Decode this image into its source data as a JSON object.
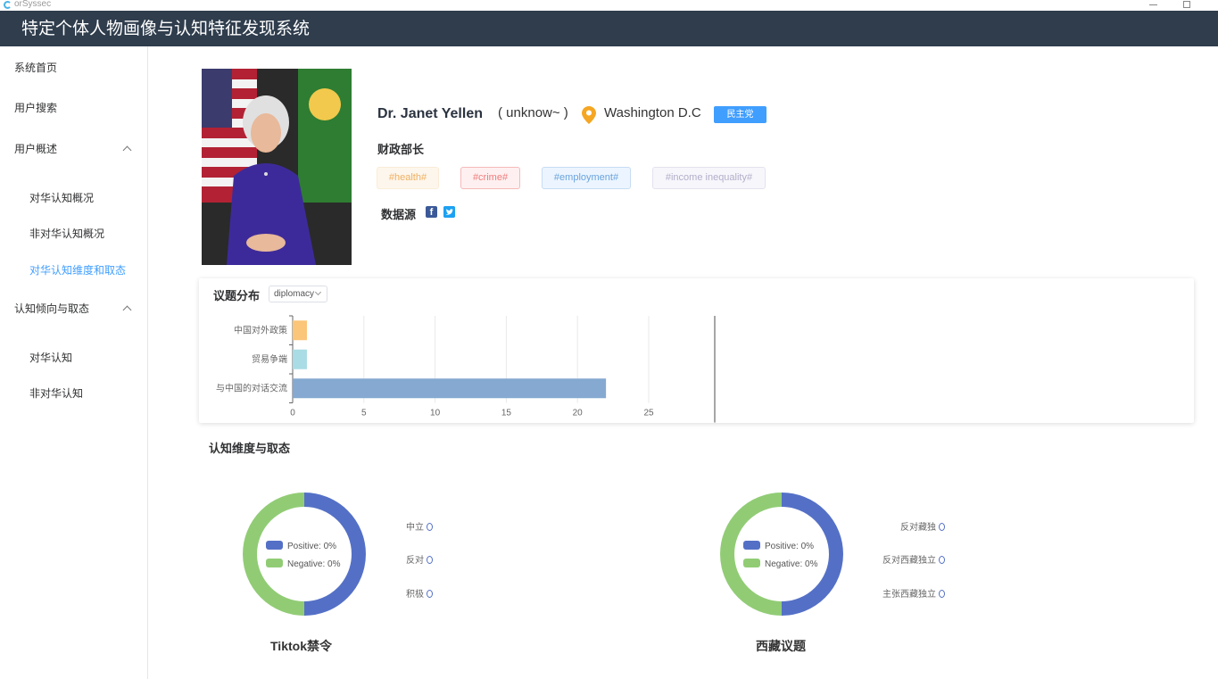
{
  "app": {
    "window_title": "orSyssec",
    "header_title": "特定个体人物画像与认知特征发现系统"
  },
  "sidebar": {
    "items": [
      {
        "label": "系统首页"
      },
      {
        "label": "用户搜索"
      },
      {
        "label": "用户概述",
        "expanded": true
      },
      {
        "label": "对华认知概况"
      },
      {
        "label": "非对华认知概况"
      },
      {
        "label": "对华认知维度和取态",
        "active": true
      },
      {
        "label": "认知倾向与取态",
        "expanded": true
      },
      {
        "label": "对华认知"
      },
      {
        "label": "非对华认知"
      }
    ]
  },
  "profile": {
    "name": "Dr. Janet Yellen",
    "username": "( unknow~ )",
    "location": "Washington D.C",
    "party": "民主党",
    "job_title": "财政部长",
    "tags": [
      "#health#",
      "#crime#",
      "#employment#",
      "#income inequality#"
    ],
    "source_label": "数据源",
    "source_icons": [
      "facebook-icon",
      "twitter-icon"
    ]
  },
  "topic_card": {
    "title": "议题分布",
    "select_value": "diplomacy"
  },
  "chart_data": {
    "type": "bar",
    "orientation": "horizontal",
    "categories": [
      "中国对外政策",
      "贸易争端",
      "与中国的对话交流"
    ],
    "values": [
      1,
      1,
      22
    ],
    "colors": [
      "#fbc57a",
      "#a9dce4",
      "#85a9d0"
    ],
    "xlim": [
      0,
      25
    ],
    "xticks": [
      0,
      5,
      10,
      15,
      20,
      25
    ],
    "grid": true
  },
  "dimension_section": {
    "title": "认知维度与取态",
    "donuts": [
      {
        "caption": "Tiktok禁令",
        "positive_label": "Positive: 0%",
        "negative_label": "Negative: 0%",
        "slices": [
          {
            "name": "Positive",
            "value": 50,
            "color": "#5470c6"
          },
          {
            "name": "Negative",
            "value": 50,
            "color": "#91cc75"
          }
        ],
        "side_labels": [
          "中立",
          "反对",
          "积极"
        ],
        "side_values": [
          "0",
          "0",
          "0"
        ]
      },
      {
        "caption": "西藏议题",
        "positive_label": "Positive: 0%",
        "negative_label": "Negative: 0%",
        "slices": [
          {
            "name": "Positive",
            "value": 50,
            "color": "#5470c6"
          },
          {
            "name": "Negative",
            "value": 50,
            "color": "#91cc75"
          }
        ],
        "side_labels": [
          "反对藏独",
          "反对西藏独立",
          "主张西藏独立"
        ],
        "side_values": [
          "0",
          "0",
          "0"
        ]
      }
    ]
  }
}
